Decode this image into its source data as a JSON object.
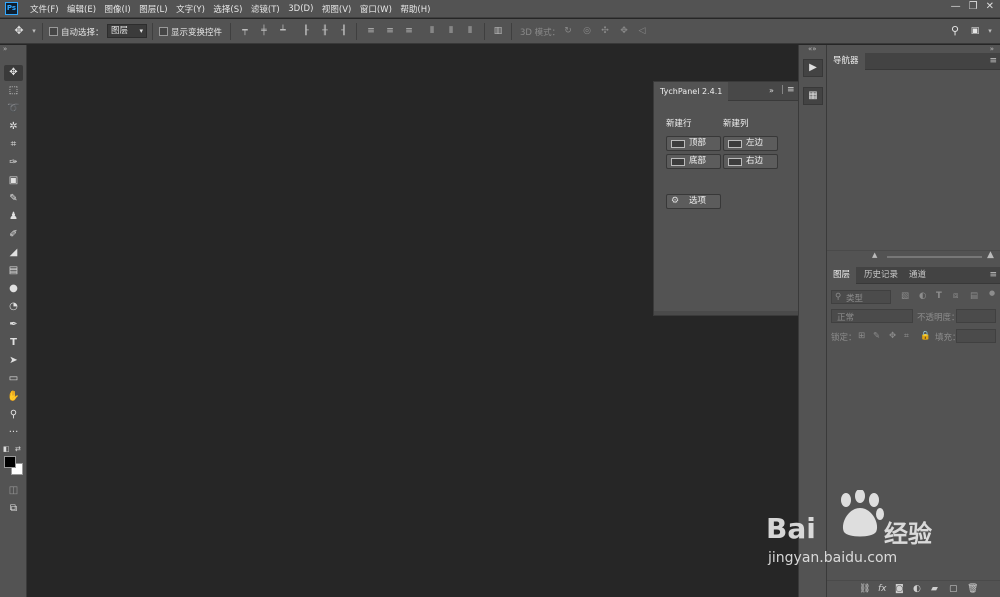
{
  "app": {
    "logo": "Ps"
  },
  "menu": [
    "文件(F)",
    "编辑(E)",
    "图像(I)",
    "图层(L)",
    "文字(Y)",
    "选择(S)",
    "滤镜(T)",
    "3D(D)",
    "视图(V)",
    "窗口(W)",
    "帮助(H)"
  ],
  "window_controls": [
    "minimize-icon",
    "restore-icon",
    "close-icon"
  ],
  "options": {
    "auto_select_label": "自动选择：",
    "auto_select_value": "图层",
    "show_transform_label": "显示变换控件",
    "mode_3d_label": "3D 模式："
  },
  "tools": [
    "move-tool-icon",
    "marquee-icon",
    "lasso-icon",
    "magic-wand-icon",
    "crop-icon",
    "eyedropper-icon",
    "healing-brush-icon",
    "brush-icon",
    "clone-stamp-icon",
    "history-brush-icon",
    "eraser-icon",
    "gradient-icon",
    "blur-icon",
    "dodge-icon",
    "pen-icon",
    "type-icon",
    "path-select-icon",
    "rectangle-icon",
    "hand-icon",
    "zoom-icon",
    "more-tools-icon"
  ],
  "colors": {
    "foreground": "#000000",
    "background": "#ffffff",
    "panel": "#535353",
    "canvas": "#262626"
  },
  "tych": {
    "tab_label": "TychPanel 2.4.1",
    "new_row_label": "新建行",
    "new_col_label": "新建列",
    "btn_top": "顶部",
    "btn_bottom": "底部",
    "btn_left": "左边",
    "btn_right": "右边",
    "btn_options": "选项"
  },
  "navigator": {
    "tab": "导航器"
  },
  "layers": {
    "tabs": [
      "图层",
      "历史记录",
      "通道"
    ],
    "kind_placeholder": "类型",
    "blend_mode": "正常",
    "opacity_label": "不透明度：",
    "lock_label": "锁定：",
    "fill_label": "填充："
  },
  "watermark": {
    "brand": "Bai",
    "brand_cn": "经验",
    "url": "jingyan.baidu.com"
  }
}
